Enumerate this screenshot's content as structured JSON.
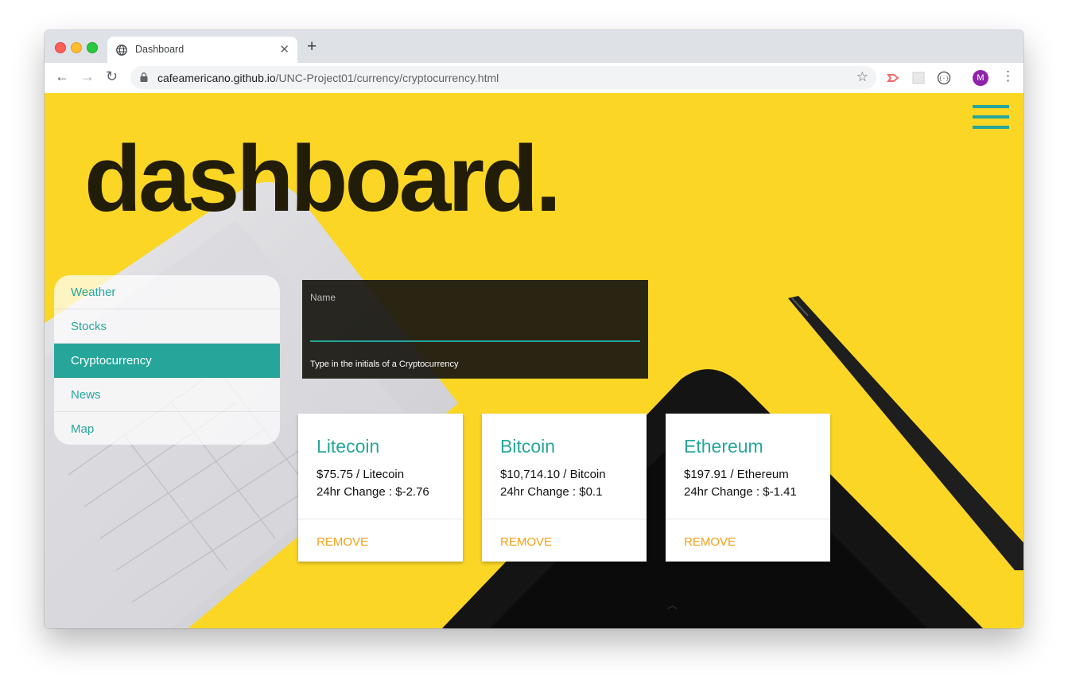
{
  "browser": {
    "tab_title": "Dashboard",
    "url_host": "cafeamericano.github.io",
    "url_path": "/UNC-Project01/currency/cryptocurrency.html",
    "profile_initial": "M"
  },
  "page": {
    "hero_title": "dashboard."
  },
  "sidebar": {
    "items": [
      {
        "label": "Weather"
      },
      {
        "label": "Stocks"
      },
      {
        "label": "Cryptocurrency",
        "active": true
      },
      {
        "label": "News"
      },
      {
        "label": "Map"
      }
    ]
  },
  "search": {
    "label": "Name",
    "value": "",
    "helper": "Type in the initials of a Cryptocurrency"
  },
  "cards": [
    {
      "name": "Litecoin",
      "price": "$75.75 / Litecoin",
      "change": "24hr Change : $-2.76",
      "action": "REMOVE"
    },
    {
      "name": "Bitcoin",
      "price": "$10,714.10 / Bitcoin",
      "change": "24hr Change : $0.1",
      "action": "REMOVE"
    },
    {
      "name": "Ethereum",
      "price": "$197.91 / Ethereum",
      "change": "24hr Change : $-1.41",
      "action": "REMOVE"
    }
  ],
  "colors": {
    "accent": "#26a69a",
    "background": "#fbd625",
    "remove": "#f4a116",
    "panel": "#191811"
  },
  "icons": [
    "globe-icon",
    "close-icon",
    "plus-icon",
    "back-arrow-icon",
    "forward-arrow-icon",
    "reload-icon",
    "lock-icon",
    "star-icon",
    "hamburger-menu-icon",
    "chevron-up-icon"
  ]
}
